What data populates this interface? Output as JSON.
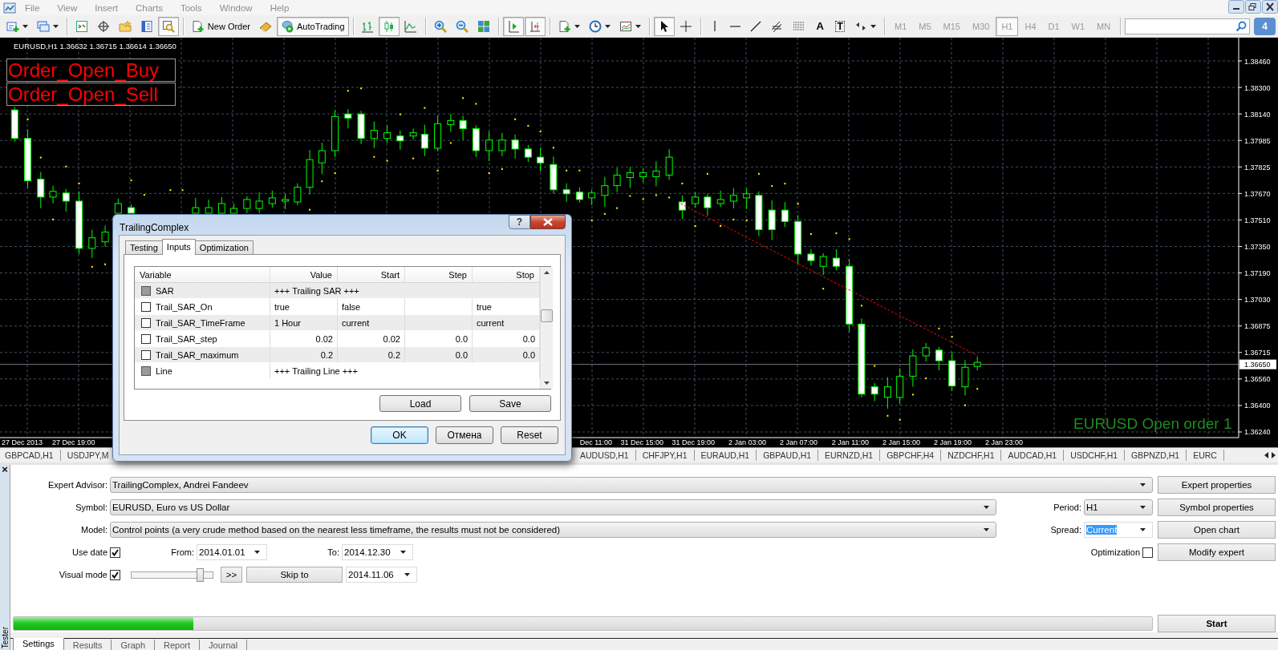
{
  "menu": {
    "items": [
      "File",
      "View",
      "Insert",
      "Charts",
      "Tools",
      "Window",
      "Help"
    ]
  },
  "toolbar": {
    "groups": [
      [
        {
          "kind": "new_chart",
          "pressed": false
        },
        {
          "kind": "profiles",
          "pressed": false
        }
      ],
      [
        {
          "kind": "market_watch",
          "pressed": false
        },
        {
          "kind": "data_window",
          "pressed": false
        },
        {
          "kind": "navigator",
          "pressed": false
        },
        {
          "kind": "terminal",
          "pressed": false
        },
        {
          "kind": "tester",
          "pressed": true
        }
      ],
      [
        {
          "kind": "new_order",
          "label": "New Order",
          "pressed": false
        },
        {
          "kind": "editor",
          "pressed": false
        },
        {
          "kind": "autotrading",
          "label": "AutoTrading",
          "pressed": true
        }
      ],
      [
        {
          "kind": "bar_chart",
          "pressed": false
        },
        {
          "kind": "candle_chart",
          "pressed": true
        },
        {
          "kind": "line_chart",
          "pressed": false
        }
      ],
      [
        {
          "kind": "zoom_in",
          "pressed": false
        },
        {
          "kind": "zoom_out",
          "pressed": false
        },
        {
          "kind": "tile",
          "pressed": false
        }
      ],
      [
        {
          "kind": "auto_scroll",
          "pressed": true
        },
        {
          "kind": "chart_shift",
          "pressed": true
        }
      ],
      [
        {
          "kind": "indicators",
          "pressed": false
        },
        {
          "kind": "periods",
          "pressed": false
        },
        {
          "kind": "templates",
          "pressed": false
        }
      ],
      [
        {
          "kind": "cursor",
          "pressed": true
        },
        {
          "kind": "crosshair",
          "pressed": false
        }
      ],
      [
        {
          "kind": "vline",
          "pressed": false
        },
        {
          "kind": "hline",
          "pressed": false
        },
        {
          "kind": "trendline",
          "pressed": false
        },
        {
          "kind": "channel",
          "pressed": false
        },
        {
          "kind": "fibo",
          "pressed": false
        },
        {
          "kind": "text",
          "label": "A",
          "pressed": false
        },
        {
          "kind": "label",
          "label": "T",
          "pressed": false
        },
        {
          "kind": "arrows",
          "pressed": false
        }
      ]
    ]
  },
  "periods": [
    {
      "label": "M1",
      "selected": false
    },
    {
      "label": "M5",
      "selected": false
    },
    {
      "label": "M15",
      "selected": false
    },
    {
      "label": "M30",
      "selected": false
    },
    {
      "label": "H1",
      "selected": true
    },
    {
      "label": "H4",
      "selected": false
    },
    {
      "label": "D1",
      "selected": false
    },
    {
      "label": "W1",
      "selected": false
    },
    {
      "label": "MN",
      "selected": false
    }
  ],
  "messages": {
    "count": "4"
  },
  "chart": {
    "header": "EURUSD,H1  1.36632 1.36715 1.36614 1.36650",
    "buttons": [
      "Order_Open_Buy",
      "Order_Open_Sell"
    ],
    "status_text": "EURUSD Open order 1",
    "price_labels": [
      "1.38460",
      "1.38300",
      "1.38140",
      "1.37985",
      "1.37825",
      "1.37670",
      "1.37510",
      "1.37350",
      "1.37190",
      "1.37030",
      "1.36875",
      "1.36715",
      "1.36560",
      "1.36400",
      "1.36240"
    ],
    "current_price": "1.36650",
    "time_labels_left": [
      "27 Dec 2013",
      "27 Dec 19:00"
    ],
    "time_labels_right": [
      "Dec 11:00",
      "31 Dec 15:00",
      "31 Dec 19:00",
      "2 Jan 03:00",
      "2 Jan 07:00",
      "2 Jan 11:00",
      "2 Jan 15:00",
      "2 Jan 19:00",
      "2 Jan 23:00"
    ]
  },
  "symbol_tabs": {
    "left": [
      "GBPCAD,H1",
      "USDJPY,M"
    ],
    "right": [
      "AUDUSD,H1",
      "CHFJPY,H1",
      "EURAUD,H1",
      "GBPAUD,H1",
      "EURNZD,H1",
      "GBPCHF,H4",
      "NZDCHF,H1",
      "AUDCAD,H1",
      "USDCHF,H1",
      "GBPNZD,H1",
      "EURC"
    ]
  },
  "dialog": {
    "title": "TrailingComplex",
    "help": "?",
    "tabs": [
      {
        "label": "Testing",
        "selected": false
      },
      {
        "label": "Inputs",
        "selected": true
      },
      {
        "label": "Optimization",
        "selected": false
      }
    ],
    "columns": [
      "Variable",
      "Value",
      "Start",
      "Step",
      "Stop"
    ],
    "rows": [
      {
        "kind": "group",
        "name": "SAR",
        "value": "+++ Trailing SAR +++",
        "checked": false,
        "disabled": true
      },
      {
        "kind": "text",
        "name": "Trail_SAR_On",
        "value": "true",
        "start": "false",
        "stop": "true",
        "checked": false,
        "disabled": false
      },
      {
        "kind": "text",
        "name": "Trail_SAR_TimeFrame",
        "value": "1 Hour",
        "start": "current",
        "stop": "current",
        "checked": false,
        "disabled": false
      },
      {
        "kind": "number",
        "name": "Trail_SAR_step",
        "value": "0.02",
        "start": "0.02",
        "step": "0.0",
        "stop": "0.0",
        "checked": false,
        "disabled": false
      },
      {
        "kind": "number",
        "name": "Trail_SAR_maximum",
        "value": "0.2",
        "start": "0.2",
        "step": "0.0",
        "stop": "0.0",
        "checked": false,
        "disabled": false
      },
      {
        "kind": "group",
        "name": "Line",
        "value": "+++ Trailing Line +++",
        "checked": false,
        "disabled": true
      }
    ],
    "panel_buttons": [
      "Load",
      "Save"
    ],
    "buttons": [
      {
        "label": "OK",
        "default": true
      },
      {
        "label": "Отмена",
        "default": false
      },
      {
        "label": "Reset",
        "default": false
      }
    ]
  },
  "tester": {
    "close": "×",
    "title": "Tester",
    "expert": {
      "label": "Expert Advisor:",
      "value": "TrailingComplex, Andrei Fandeev"
    },
    "symbol": {
      "label": "Symbol:",
      "value": "EURUSD, Euro vs US Dollar"
    },
    "model": {
      "label": "Model:",
      "value": "Control points (a very crude method based on the nearest less timeframe, the results must not be considered)"
    },
    "period": {
      "label": "Period:",
      "value": "H1"
    },
    "spread": {
      "label": "Spread:",
      "value": "Current",
      "selected": true
    },
    "use_date": {
      "label": "Use date",
      "checked": true
    },
    "from": {
      "label": "From:",
      "value": "2014.01.01"
    },
    "to": {
      "label": "To:",
      "value": "2014.12.30"
    },
    "optimization": {
      "label": "Optimization",
      "checked": false
    },
    "visual_mode": {
      "label": "Visual mode",
      "checked": true
    },
    "speed": {
      "level": 0.88
    },
    "fast_forward": ">>",
    "skip_to": "Skip to",
    "skip_date": "2014.11.06",
    "side_buttons": [
      "Expert properties",
      "Symbol properties",
      "Open chart",
      "Modify expert"
    ],
    "progress": {
      "level": 0.158
    },
    "start": "Start",
    "tabs": [
      {
        "label": "Settings",
        "selected": true
      },
      {
        "label": "Results",
        "selected": false
      },
      {
        "label": "Graph",
        "selected": false
      },
      {
        "label": "Report",
        "selected": false
      },
      {
        "label": "Journal",
        "selected": false
      }
    ]
  }
}
